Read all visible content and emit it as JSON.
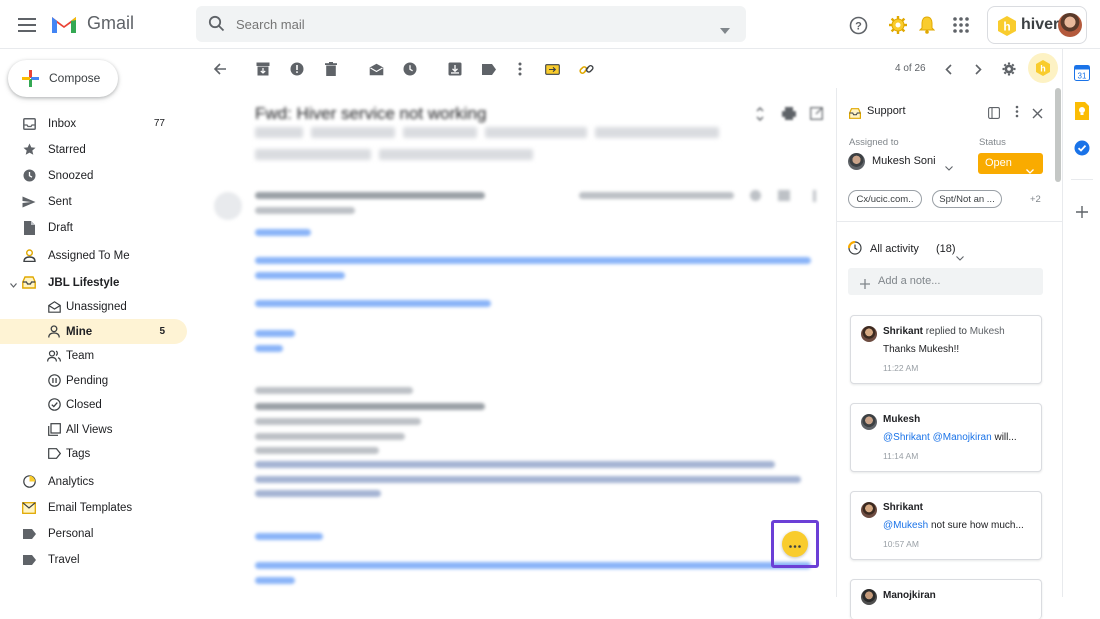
{
  "app": {
    "name": "Gmail"
  },
  "search": {
    "placeholder": "Search mail"
  },
  "compose": {
    "label": "Compose"
  },
  "hiver": {
    "brand": "hiver"
  },
  "sidebar": {
    "items": [
      {
        "label": "Inbox",
        "count": "77"
      },
      {
        "label": "Starred"
      },
      {
        "label": "Snoozed"
      },
      {
        "label": "Sent"
      },
      {
        "label": "Draft"
      },
      {
        "label": "Assigned To Me"
      },
      {
        "label": "JBL Lifestyle"
      },
      {
        "label": "Unassigned"
      },
      {
        "label": "Mine",
        "count": "5"
      },
      {
        "label": "Team"
      },
      {
        "label": "Pending"
      },
      {
        "label": "Closed"
      },
      {
        "label": "All Views"
      },
      {
        "label": "Tags"
      },
      {
        "label": "Analytics"
      },
      {
        "label": "Email Templates"
      },
      {
        "label": "Personal"
      },
      {
        "label": "Travel"
      }
    ]
  },
  "toolbar": {
    "pagination": "4 of 26"
  },
  "email": {
    "subject": "Fwd: Hiver service not working"
  },
  "panel": {
    "title": "Support",
    "assigned_label": "Assigned to",
    "assignee": "Mukesh Soni",
    "status_label": "Status",
    "status": "Open",
    "tags": [
      "Cx/ucic.com..",
      "Spt/Not an ..."
    ],
    "more_tags": "+2",
    "activity_label": "All activity",
    "activity_count": "(18)",
    "note_placeholder": "Add a note...",
    "activities": [
      {
        "author": "Shrikant",
        "verb": "replied to",
        "target": "Mukesh",
        "text": "Thanks Mukesh!!",
        "time": "11:22 AM"
      },
      {
        "author": "Mukesh",
        "mentions": "@Shrikant @Manojkiran",
        "text": "will...",
        "time": "11:14 AM"
      },
      {
        "author": "Shrikant",
        "mentions": "@Mukesh",
        "text": "not sure how much...",
        "time": "10:57 AM"
      },
      {
        "author": "Manojkiran"
      }
    ]
  },
  "colors": {
    "accent": "#f9cc2d",
    "status": "#f9ab00",
    "highlight": "#6b3fd6",
    "link": "#1a73e8"
  }
}
